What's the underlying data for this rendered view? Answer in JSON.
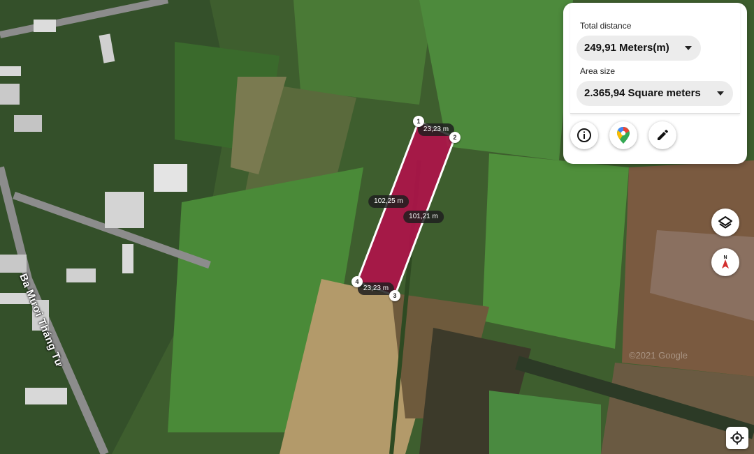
{
  "map": {
    "street_name": "Ba Mươi Tháng Tư",
    "watermark": "©2021 Google",
    "vertices": [
      "1",
      "2",
      "3",
      "4"
    ],
    "segment_labels": {
      "top": "23,23 m",
      "bottom": "23,23 m",
      "left": "102,25 m",
      "right": "101,21 m"
    },
    "polygon_color": "#b0124a"
  },
  "panel": {
    "distance_label": "Total distance",
    "distance_value": "249,91 Meters(m)",
    "area_label": "Area size",
    "area_value": "2.365,94 Square meters"
  },
  "icons": {
    "info": "info-icon",
    "maps": "google-maps-icon",
    "edit": "pencil-icon",
    "layers": "layers-icon",
    "compass": "compass-icon",
    "location": "my-location-icon"
  },
  "colors": {
    "accent_red": "#d32f2f",
    "panel_bg": "#ffffff",
    "select_bg": "#ececec"
  }
}
